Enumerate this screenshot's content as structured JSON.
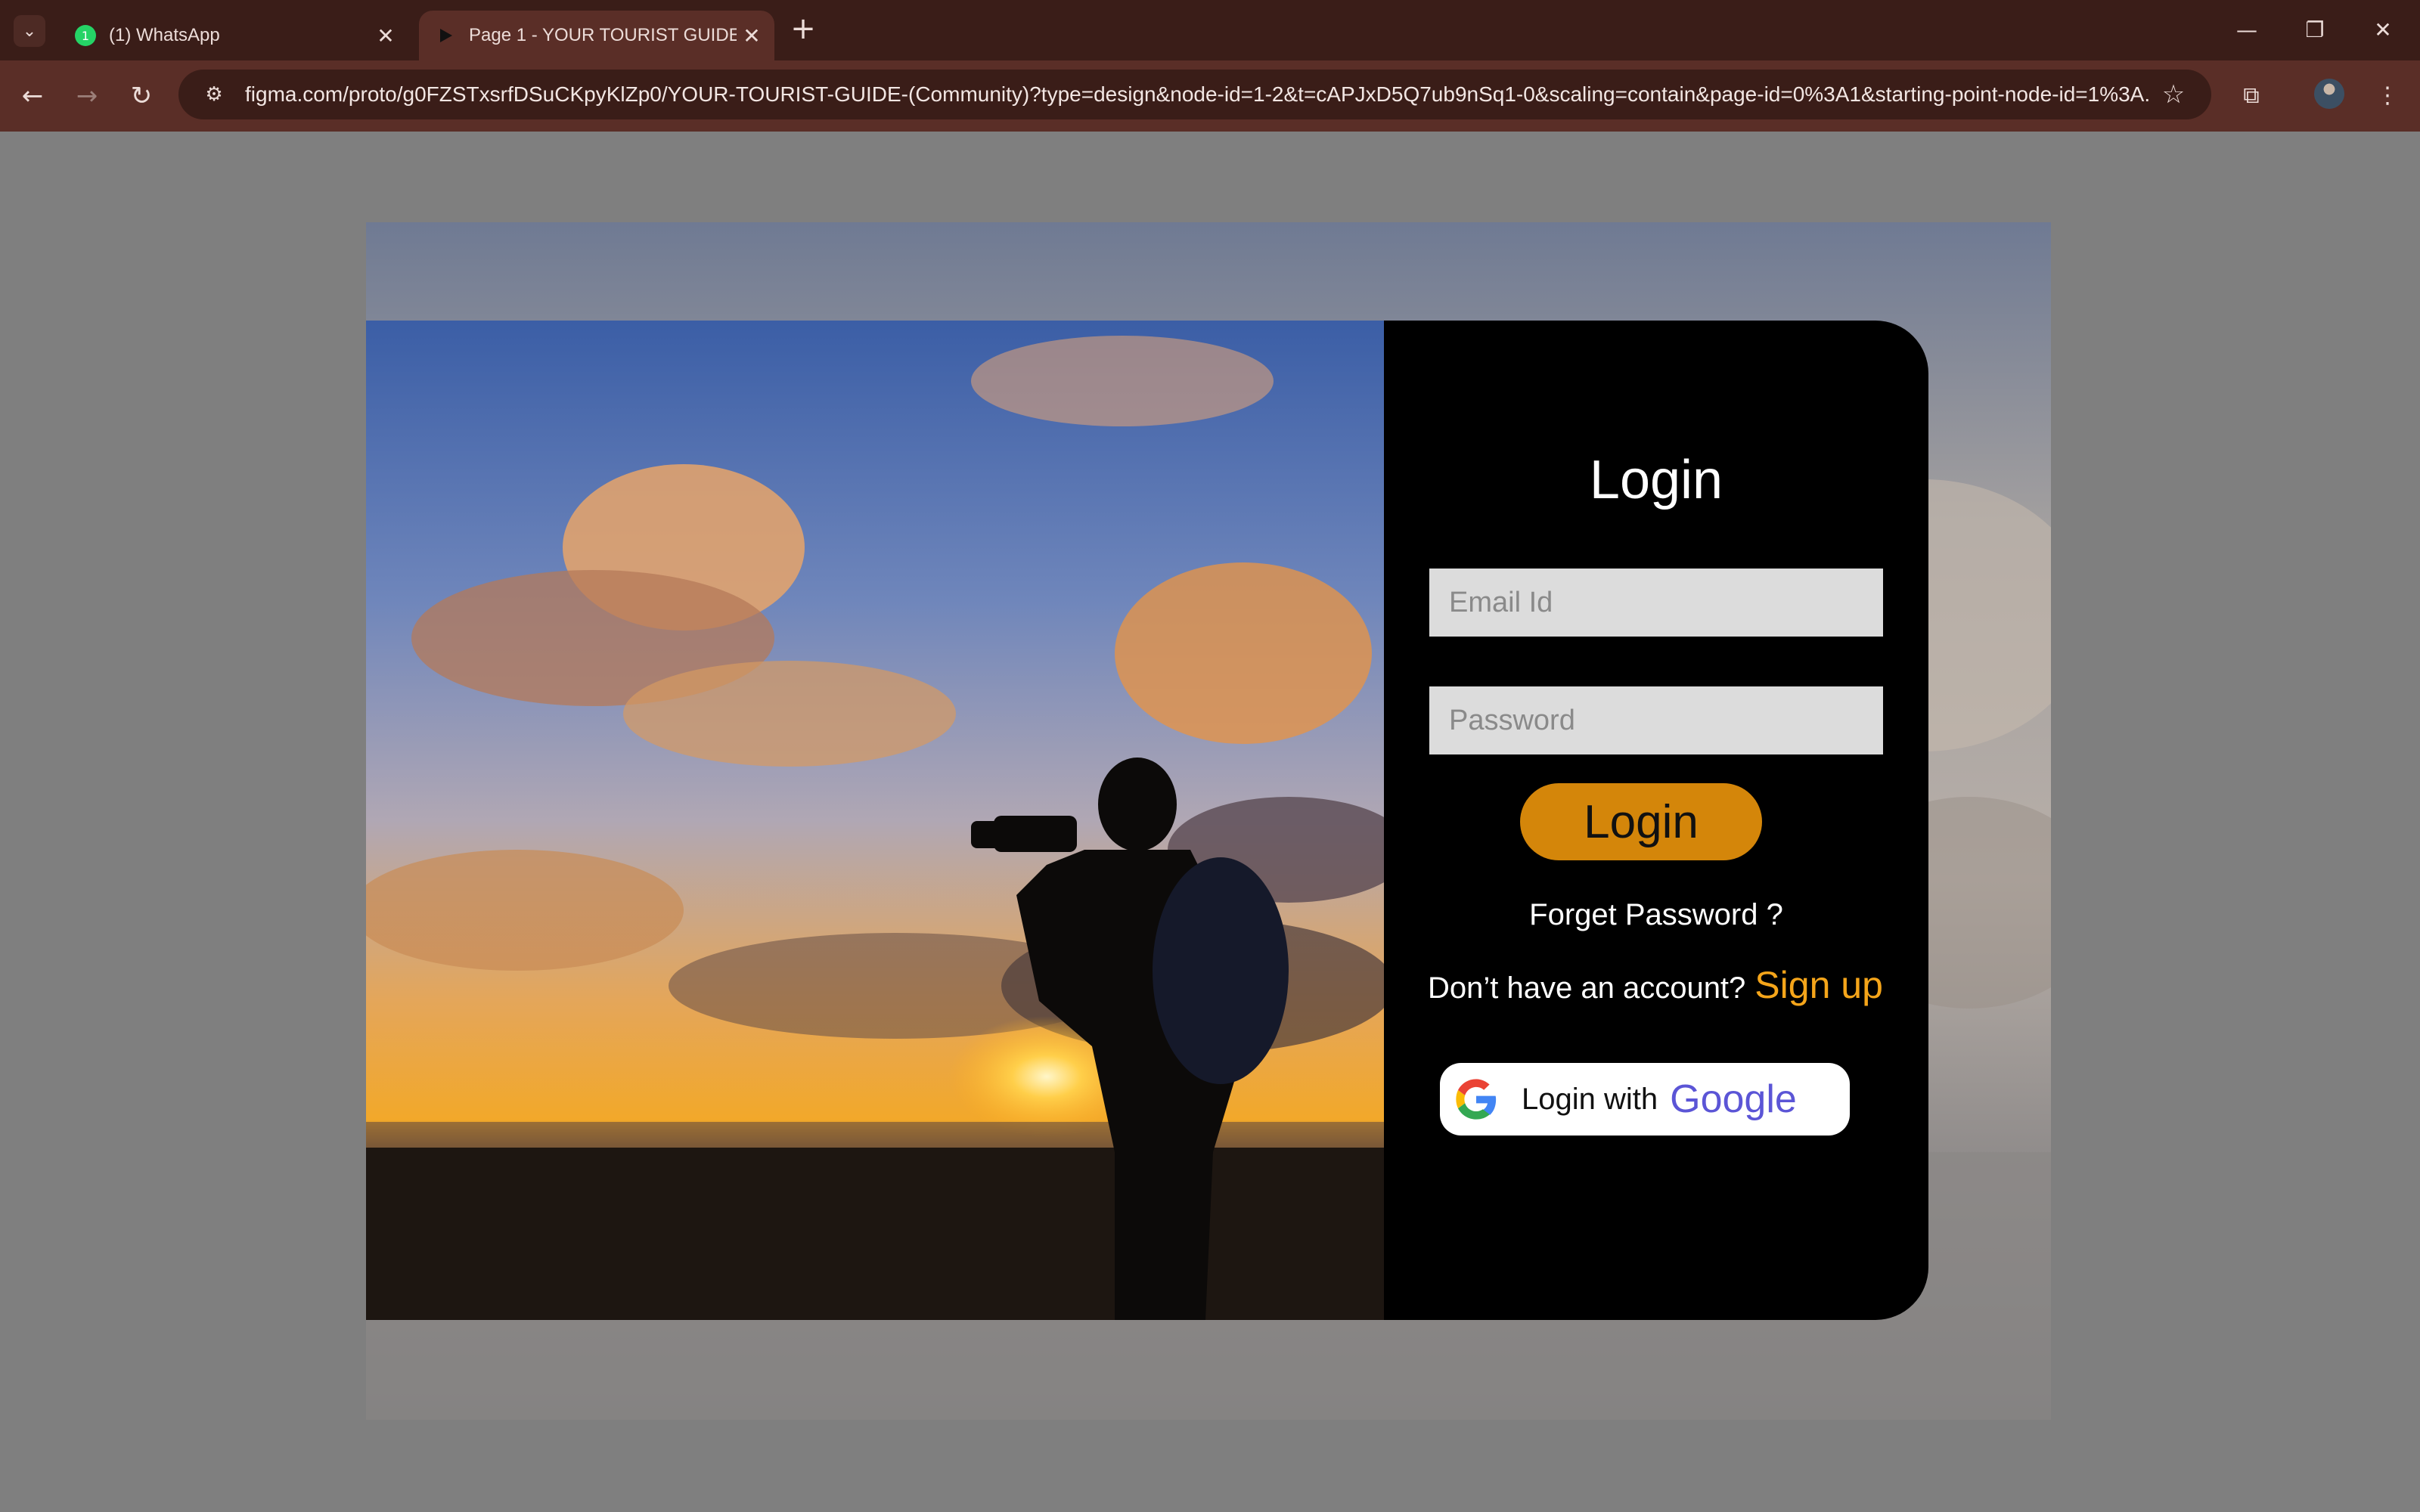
{
  "browser": {
    "tabs": [
      {
        "title": "(1) WhatsApp",
        "icon": "whatsapp-icon",
        "badge": "1"
      },
      {
        "title": "Page 1 - YOUR TOURIST GUIDE",
        "icon": "figma-play-icon"
      }
    ],
    "url": "figma.com/proto/g0FZSTxsrfDSuCKpyKlZp0/YOUR-TOURIST-GUIDE-(Community)?type=design&node-id=1-2&t=cAPJxD5Q7ub9nSq1-0&scaling=contain&page-id=0%3A1&starting-point-node-id=1%3A..."
  },
  "login": {
    "title": "Login",
    "email_placeholder": "Email Id",
    "password_placeholder": "Password",
    "login_button": "Login",
    "forget_password": "Forget Password ?",
    "no_account": "Don’t have an account?",
    "signup": "Sign up",
    "google_prefix": "Login with",
    "google_brand": "Google"
  },
  "colors": {
    "accent": "#d4860a",
    "signup": "#f5a51a",
    "google_text": "#5b55d6",
    "panel": "#000000"
  }
}
